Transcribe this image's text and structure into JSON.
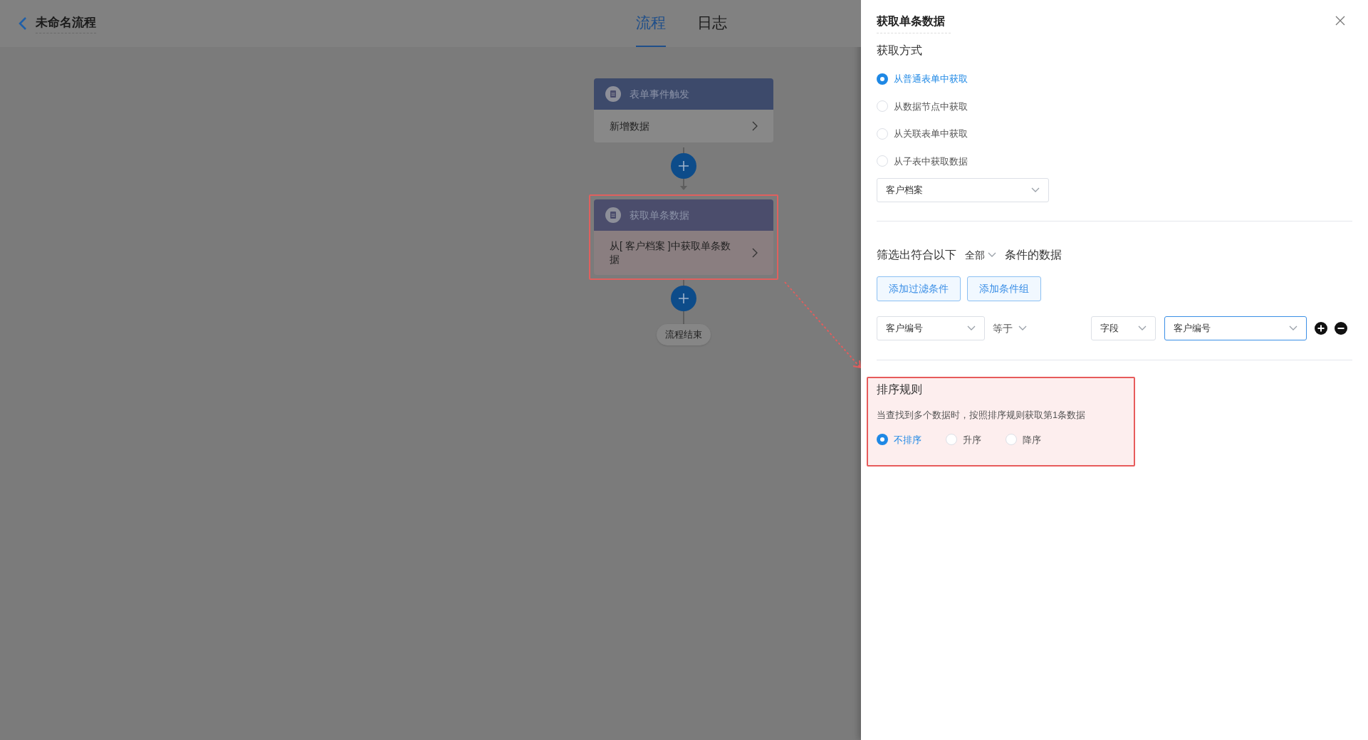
{
  "header": {
    "title": "未命名流程",
    "tabs": [
      {
        "label": "流程",
        "selected": true
      },
      {
        "label": "日志",
        "selected": false
      }
    ]
  },
  "flow": {
    "nodes": [
      {
        "title": "表单事件触发",
        "body": "新增数据",
        "highlighted": false
      },
      {
        "title": "获取单条数据",
        "body": "从[ 客户档案 ]中获取单条数据",
        "highlighted": true
      }
    ],
    "end": "流程结束"
  },
  "panel": {
    "title": "获取单条数据",
    "fetch_method": {
      "label": "获取方式",
      "options": [
        {
          "label": "从普通表单中获取",
          "selected": true
        },
        {
          "label": "从数据节点中获取",
          "selected": false
        },
        {
          "label": "从关联表单中获取",
          "selected": false
        },
        {
          "label": "从子表中获取数据",
          "selected": false
        }
      ]
    },
    "source_select": "客户档案",
    "filter": {
      "prefix": "筛选出符合以下",
      "scope": "全部",
      "suffix": "条件的数据"
    },
    "buttons": [
      "添加过滤条件",
      "添加条件组"
    ],
    "condition": {
      "field": "客户编号",
      "operator": "等于",
      "value_type": "字段",
      "value": "客户编号"
    },
    "sort": {
      "highlighted": true,
      "title": "排序规则",
      "description": "当查找到多个数据时，按照排序规则获取第1条数据",
      "options": [
        {
          "label": "不排序",
          "selected": true
        },
        {
          "label": "升序",
          "selected": false
        },
        {
          "label": "降序",
          "selected": false
        }
      ]
    }
  }
}
